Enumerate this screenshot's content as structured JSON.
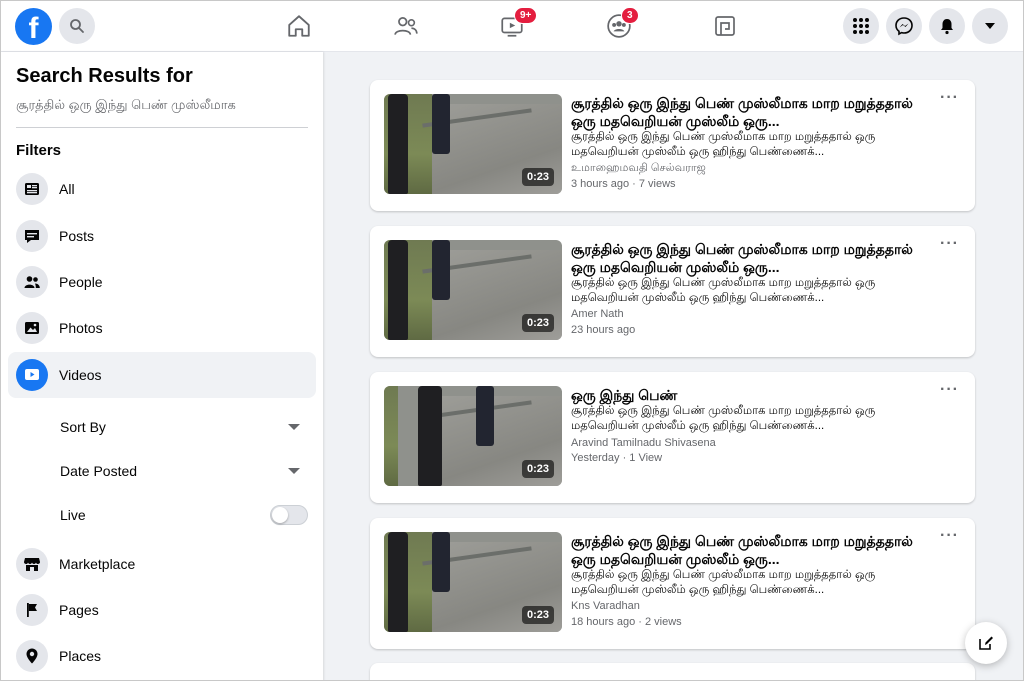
{
  "topbar": {
    "logo": "f",
    "watch_badge": "9+",
    "groups_badge": "3"
  },
  "sidebar": {
    "title": "Search Results for",
    "query": "சூரத்தில் ஒரு இந்து பெண் முஸ்லீமாக",
    "filters_label": "Filters",
    "items": [
      {
        "label": "All",
        "icon": "feed-icon"
      },
      {
        "label": "Posts",
        "icon": "posts-icon"
      },
      {
        "label": "People",
        "icon": "people-icon"
      },
      {
        "label": "Photos",
        "icon": "photos-icon"
      },
      {
        "label": "Videos",
        "icon": "videos-icon",
        "active": true
      },
      {
        "label": "Marketplace",
        "icon": "marketplace-icon"
      },
      {
        "label": "Pages",
        "icon": "flag-icon"
      },
      {
        "label": "Places",
        "icon": "pin-icon"
      }
    ],
    "sort_by": "Sort By",
    "date_posted": "Date Posted",
    "live": "Live",
    "live_on": false
  },
  "results": [
    {
      "title": "சூரத்தில் ஒரு இந்து பெண் முஸ்லீமாக மாற மறுத்ததால் ஒரு மதவெறியன் முஸ்லீம் ஒரு...",
      "desc": "சூரத்தில் ஒரு இந்து பெண் முஸ்லீமாக மாற மறுத்ததால் ஒரு மதவெறியன் முஸ்லீம் ஒரு ஹிந்து பெண்ணைக்...",
      "author": "உமாஹைமவதி செல்வராஜ",
      "meta": "3 hours ago · 7 views",
      "duration": "0:23"
    },
    {
      "title": "சூரத்தில் ஒரு இந்து பெண் முஸ்லீமாக மாற மறுத்ததால் ஒரு மதவெறியன் முஸ்லீம் ஒரு...",
      "desc": "சூரத்தில் ஒரு இந்து பெண் முஸ்லீமாக மாற மறுத்ததால் ஒரு மதவெறியன் முஸ்லீம் ஒரு ஹிந்து பெண்ணைக்...",
      "author": "Amer Nath",
      "meta": "23 hours ago",
      "duration": "0:23"
    },
    {
      "title": "ஒரு இந்து பெண்",
      "desc": "சூரத்தில் ஒரு இந்து பெண் முஸ்லீமாக மாற மறுத்ததால் ஒரு மதவெறியன் முஸ்லீம் ஒரு ஹிந்து பெண்ணைக்...",
      "author": "Aravind Tamilnadu Shivasena",
      "meta": "Yesterday · 1 View",
      "duration": "0:23"
    },
    {
      "title": "சூரத்தில் ஒரு இந்து பெண் முஸ்லீமாக மாற மறுத்ததால் ஒரு மதவெறியன் முஸ்லீம் ஒரு...",
      "desc": "சூரத்தில் ஒரு இந்து பெண் முஸ்லீமாக மாற மறுத்ததால் ஒரு மதவெறியன் முஸ்லீம் ஒரு ஹிந்து பெண்ணைக்...",
      "author": "Kns Varadhan",
      "meta": "18 hours ago · 2 views",
      "duration": "0:23"
    }
  ],
  "colors": {
    "brand": "#1877f2",
    "badge": "#e41e3f",
    "background": "#f0f2f5"
  }
}
